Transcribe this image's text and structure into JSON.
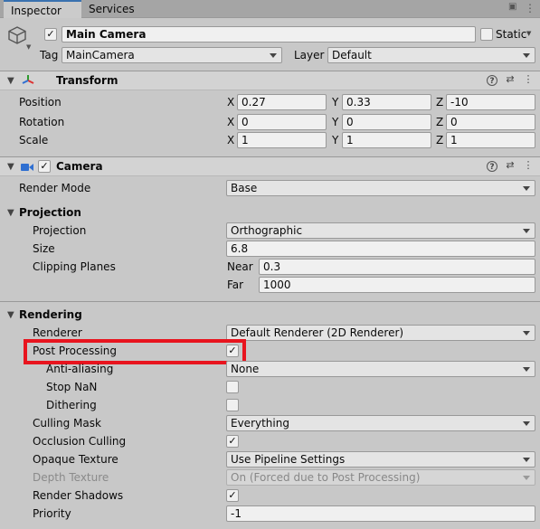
{
  "tabs": [
    {
      "label": "Inspector"
    },
    {
      "label": "Services"
    }
  ],
  "gameobject": {
    "name": "Main Camera",
    "active": true,
    "static_label": "Static",
    "tag_label": "Tag",
    "tag_value": "MainCamera",
    "layer_label": "Layer",
    "layer_value": "Default"
  },
  "transform": {
    "title": "Transform",
    "rows": [
      {
        "label": "Position",
        "x": "0.27",
        "y": "0.33",
        "z": "-10"
      },
      {
        "label": "Rotation",
        "x": "0",
        "y": "0",
        "z": "0"
      },
      {
        "label": "Scale",
        "x": "1",
        "y": "1",
        "z": "1"
      }
    ],
    "axis": {
      "x": "X",
      "y": "Y",
      "z": "Z"
    }
  },
  "camera": {
    "title": "Camera",
    "enabled": true,
    "render_mode_label": "Render Mode",
    "render_mode_value": "Base",
    "projection_header": "Projection",
    "projection_label": "Projection",
    "projection_value": "Orthographic",
    "size_label": "Size",
    "size_value": "6.8",
    "clipping_label": "Clipping Planes",
    "near_label": "Near",
    "near_value": "0.3",
    "far_label": "Far",
    "far_value": "1000",
    "rendering_header": "Rendering",
    "renderer_label": "Renderer",
    "renderer_value": "Default Renderer (2D Renderer)",
    "post_processing_label": "Post Processing",
    "post_processing": true,
    "anti_aliasing_label": "Anti-aliasing",
    "anti_aliasing_value": "None",
    "stop_nan_label": "Stop NaN",
    "stop_nan": false,
    "dithering_label": "Dithering",
    "dithering": false,
    "culling_mask_label": "Culling Mask",
    "culling_mask_value": "Everything",
    "occlusion_label": "Occlusion Culling",
    "occlusion": true,
    "opaque_label": "Opaque Texture",
    "opaque_value": "Use Pipeline Settings",
    "depth_label": "Depth Texture",
    "depth_value": "On (Forced due to Post Processing)",
    "shadows_label": "Render Shadows",
    "shadows": true,
    "priority_label": "Priority",
    "priority_value": "-1"
  },
  "glyphs": {
    "check": "✓",
    "fold_open": "▼",
    "help": "?",
    "lock": "🔒",
    "menu": "⋮",
    "presets": "⇄"
  },
  "colors": {
    "highlight": "#e8141e",
    "tab_accent": "#3a72b0"
  }
}
